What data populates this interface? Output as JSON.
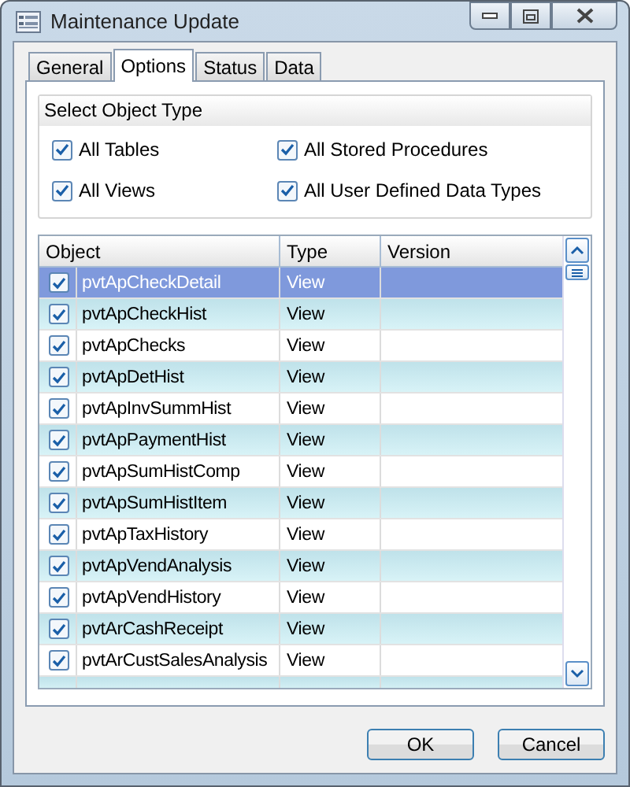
{
  "window": {
    "title": "Maintenance Update"
  },
  "tabs": [
    {
      "label": "General",
      "selected": false
    },
    {
      "label": "Options",
      "selected": true
    },
    {
      "label": "Status",
      "selected": false
    },
    {
      "label": "Data",
      "selected": false
    }
  ],
  "object_type_group": {
    "title": "Select Object Type",
    "options": [
      {
        "label": "All Tables",
        "checked": true
      },
      {
        "label": "All Stored Procedures",
        "checked": true
      },
      {
        "label": "All Views",
        "checked": true
      },
      {
        "label": "All User Defined Data Types",
        "checked": true
      }
    ]
  },
  "table": {
    "columns": [
      "Object",
      "Type",
      "Version"
    ],
    "rows": [
      {
        "object": "pvtApCheckDetail",
        "type": "View",
        "checked": true,
        "selected": true
      },
      {
        "object": "pvtApCheckHist",
        "type": "View",
        "checked": true,
        "selected": false
      },
      {
        "object": "pvtApChecks",
        "type": "View",
        "checked": true,
        "selected": false
      },
      {
        "object": "pvtApDetHist",
        "type": "View",
        "checked": true,
        "selected": false
      },
      {
        "object": "pvtApInvSummHist",
        "type": "View",
        "checked": true,
        "selected": false
      },
      {
        "object": "pvtApPaymentHist",
        "type": "View",
        "checked": true,
        "selected": false
      },
      {
        "object": "pvtApSumHistComp",
        "type": "View",
        "checked": true,
        "selected": false
      },
      {
        "object": "pvtApSumHistItem",
        "type": "View",
        "checked": true,
        "selected": false
      },
      {
        "object": "pvtApTaxHistory",
        "type": "View",
        "checked": true,
        "selected": false
      },
      {
        "object": "pvtApVendAnalysis",
        "type": "View",
        "checked": true,
        "selected": false
      },
      {
        "object": "pvtApVendHistory",
        "type": "View",
        "checked": true,
        "selected": false
      },
      {
        "object": "pvtArCashReceipt",
        "type": "View",
        "checked": true,
        "selected": false
      },
      {
        "object": "pvtArCustSalesAnalysis",
        "type": "View",
        "checked": true,
        "selected": false
      }
    ]
  },
  "buttons": [
    "OK",
    "Cancel"
  ]
}
